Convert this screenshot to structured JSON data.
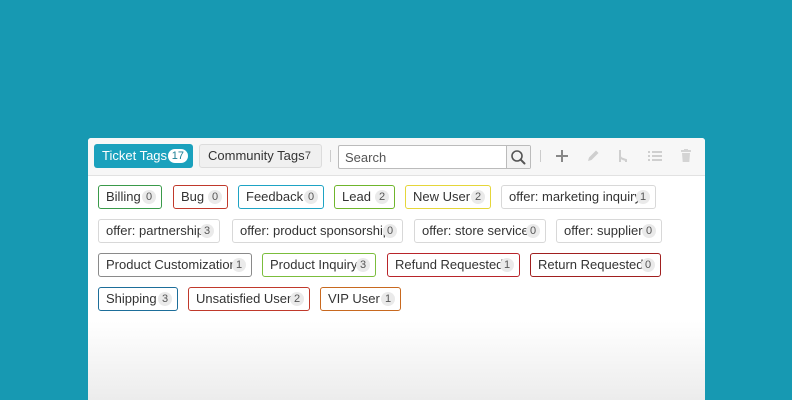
{
  "tabs": [
    {
      "label": "Ticket Tags",
      "count": "17",
      "active": true
    },
    {
      "label": "Community Tags",
      "count": "7",
      "active": false
    }
  ],
  "search": {
    "placeholder": "Search",
    "value": ""
  },
  "toolbar_icons": [
    "plus-icon",
    "pencil-icon",
    "merge-icon",
    "list-icon",
    "trash-icon"
  ],
  "colors": {
    "background": "#1799b2",
    "accent": "#1aa1bd"
  },
  "tags": [
    {
      "label": "Billing",
      "count": "0",
      "color": "#3a9a4a"
    },
    {
      "label": "Bug",
      "count": "0",
      "color": "#c0392b"
    },
    {
      "label": "Feedback",
      "count": "0",
      "color": "#1ea3c4"
    },
    {
      "label": "Lead",
      "count": "2",
      "color": "#6fb52c"
    },
    {
      "label": "New User",
      "count": "2",
      "color": "#e5d63a"
    },
    {
      "label": "offer: marketing inquiry",
      "count": "1",
      "color": "#d8d8d8"
    },
    {
      "label": "offer: partnership",
      "count": "3",
      "color": "#d8d8d8"
    },
    {
      "label": "offer: product sponsorship",
      "count": "0",
      "color": "#d8d8d8"
    },
    {
      "label": "offer: store service",
      "count": "0",
      "color": "#d8d8d8"
    },
    {
      "label": "offer: supplier",
      "count": "0",
      "color": "#d8d8d8"
    },
    {
      "label": "Product Customization",
      "count": "1",
      "color": "#8a8a8a"
    },
    {
      "label": "Product Inquiry",
      "count": "3",
      "color": "#7bbd3c"
    },
    {
      "label": "Refund Requested",
      "count": "1",
      "color": "#b8242a"
    },
    {
      "label": "Return Requested",
      "count": "0",
      "color": "#a01f1f"
    },
    {
      "label": "Shipping",
      "count": "3",
      "color": "#1d6e9a"
    },
    {
      "label": "Unsatisfied User",
      "count": "2",
      "color": "#c0392b"
    },
    {
      "label": "VIP User",
      "count": "1",
      "color": "#c8691f"
    }
  ]
}
